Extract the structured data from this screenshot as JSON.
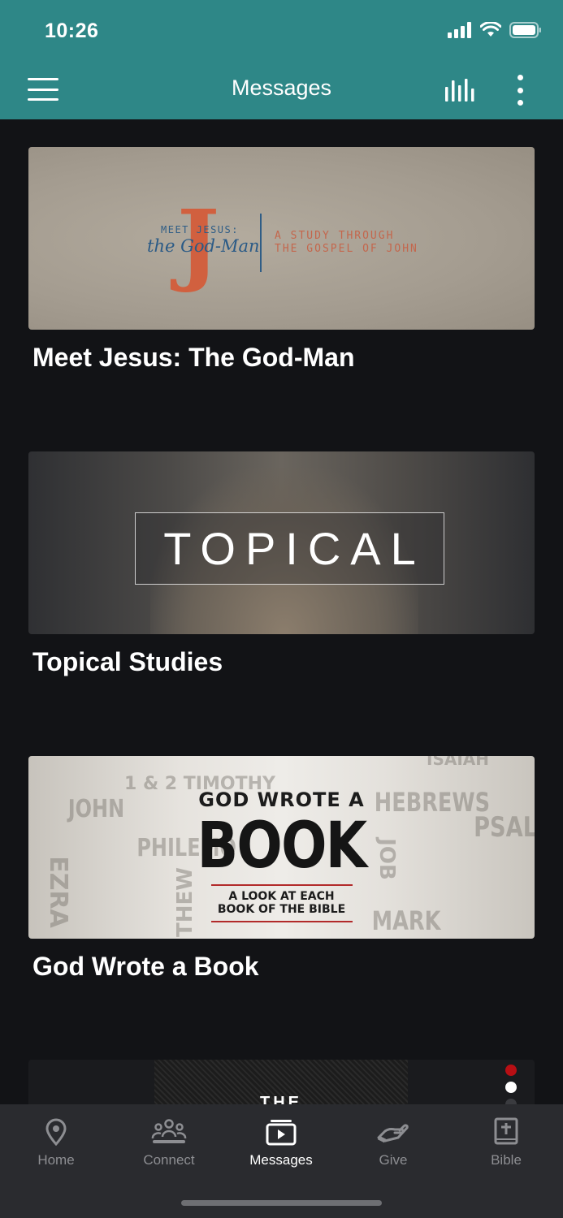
{
  "status": {
    "time": "10:26"
  },
  "header": {
    "title": "Messages"
  },
  "cards": [
    {
      "title": "Meet Jesus: The God-Man",
      "art": {
        "top": "MEET JESUS:",
        "script": "the God-Man",
        "letter": "J",
        "study_line1": "A STUDY THROUGH",
        "study_line2": "THE GOSPEL OF JOHN"
      }
    },
    {
      "title": "Topical Studies",
      "art": {
        "word": "TOPICAL"
      }
    },
    {
      "title": "God Wrote a Book",
      "art": {
        "top": "GOD WROTE A",
        "big": "BOOK",
        "sub_line1": "A LOOK AT EACH",
        "sub_line2": "BOOK OF THE BIBLE",
        "background_words": [
          "1 & 2 TIMOTHY",
          "JOHN",
          "PHILEMO",
          "EZRA",
          "THEW",
          "HEBREWS",
          "JOB",
          "PSALM",
          "MARK",
          "ISAIAH"
        ]
      }
    },
    {
      "title": "",
      "art": {
        "partial_text": "THE"
      }
    }
  ],
  "tabs": [
    {
      "label": "Home",
      "icon": "map-pin-icon"
    },
    {
      "label": "Connect",
      "icon": "people-group-icon"
    },
    {
      "label": "Messages",
      "icon": "media-play-icon"
    },
    {
      "label": "Give",
      "icon": "giving-hand-icon"
    },
    {
      "label": "Bible",
      "icon": "bible-cross-icon"
    }
  ],
  "colors": {
    "header": "#2e8787",
    "background": "#121316",
    "tabbar": "#2a2b2f",
    "accent_dot": "#b80f14"
  }
}
